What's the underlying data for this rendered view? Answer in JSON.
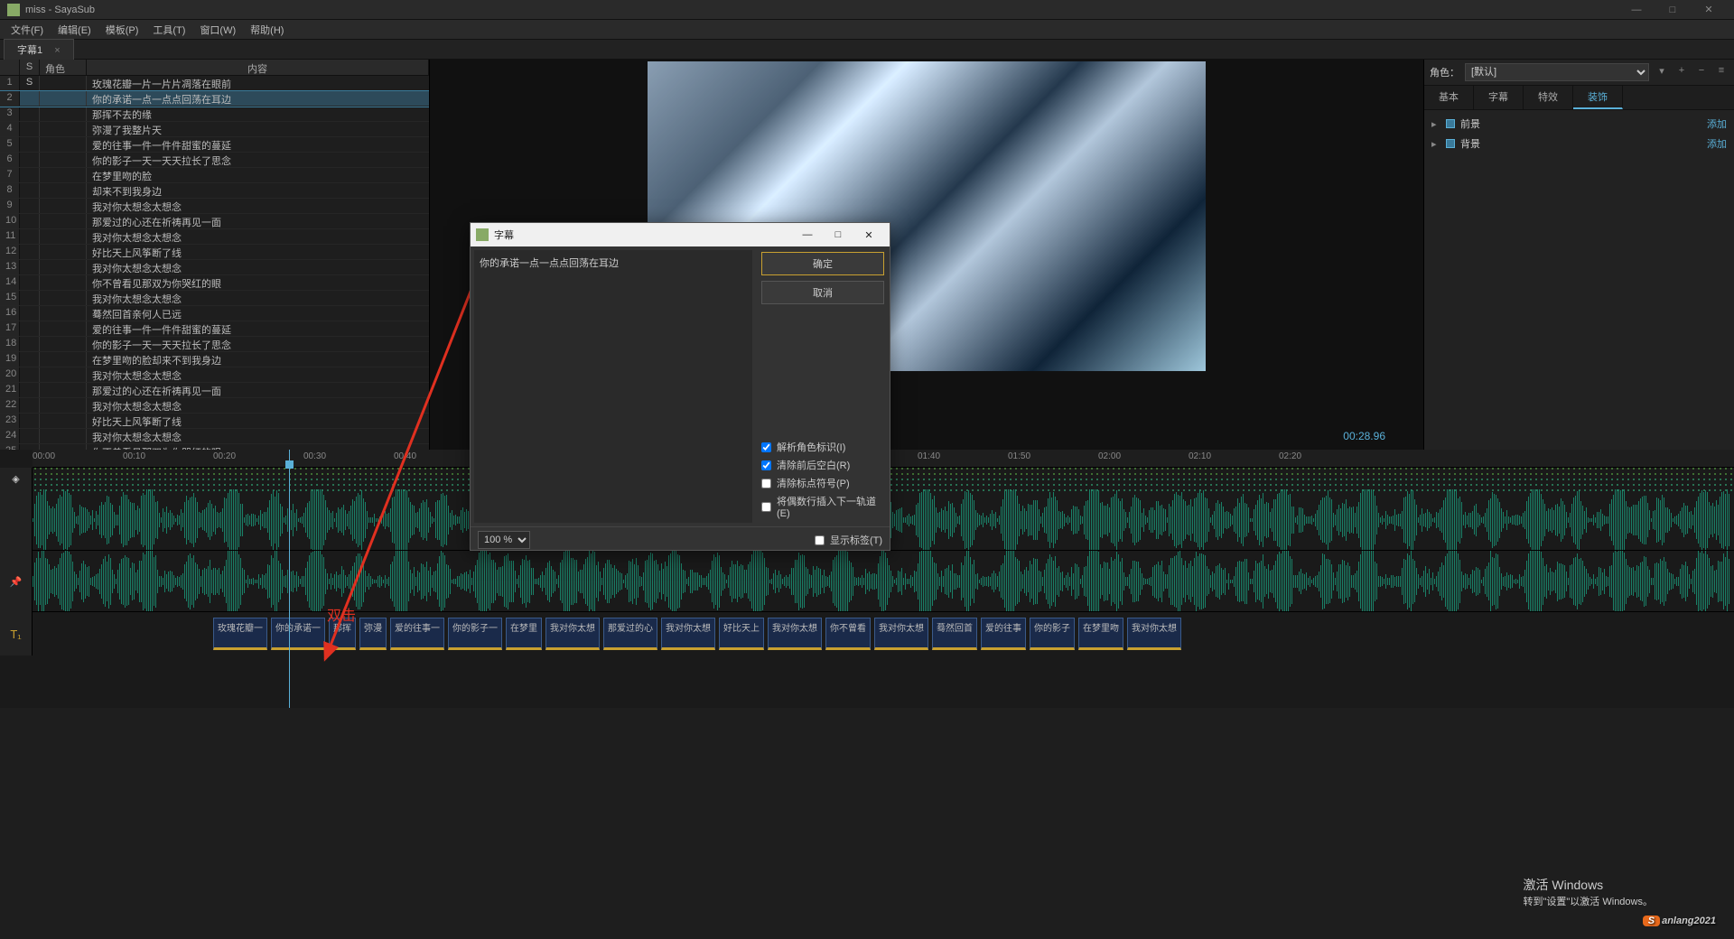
{
  "titlebar": {
    "title": "miss - SayaSub"
  },
  "menu": [
    "文件(F)",
    "编辑(E)",
    "模板(P)",
    "工具(T)",
    "窗口(W)",
    "帮助(H)"
  ],
  "tab": {
    "name": "字幕1"
  },
  "table": {
    "headers": {
      "s": "S",
      "role": "角色",
      "content": "内容"
    },
    "rows": [
      {
        "n": "1",
        "s": "S",
        "content": "玫瑰花瓣一片一片片凋落在眼前"
      },
      {
        "n": "2",
        "s": "",
        "content": "你的承诺一点一点点回荡在耳边",
        "selected": true
      },
      {
        "n": "3",
        "s": "",
        "content": "那挥不去的缘"
      },
      {
        "n": "4",
        "s": "",
        "content": "弥漫了我整片天"
      },
      {
        "n": "5",
        "s": "",
        "content": "爱的往事一件一件件甜蜜的蔓延"
      },
      {
        "n": "6",
        "s": "",
        "content": "你的影子一天一天天拉长了思念"
      },
      {
        "n": "7",
        "s": "",
        "content": "在梦里吻的脸"
      },
      {
        "n": "8",
        "s": "",
        "content": "却来不到我身边"
      },
      {
        "n": "9",
        "s": "",
        "content": "我对你太想念太想念"
      },
      {
        "n": "10",
        "s": "",
        "content": "那爱过的心还在祈祷再见一面"
      },
      {
        "n": "11",
        "s": "",
        "content": "我对你太想念太想念"
      },
      {
        "n": "12",
        "s": "",
        "content": "好比天上风筝断了线"
      },
      {
        "n": "13",
        "s": "",
        "content": "我对你太想念太想念"
      },
      {
        "n": "14",
        "s": "",
        "content": "你不曾看见那双为你哭红的眼"
      },
      {
        "n": "15",
        "s": "",
        "content": "我对你太想念太想念"
      },
      {
        "n": "16",
        "s": "",
        "content": "蓦然回首亲何人已远"
      },
      {
        "n": "17",
        "s": "",
        "content": "爱的往事一件一件件甜蜜的蔓延"
      },
      {
        "n": "18",
        "s": "",
        "content": "你的影子一天一天天拉长了思念"
      },
      {
        "n": "19",
        "s": "",
        "content": "在梦里吻的脸却来不到我身边"
      },
      {
        "n": "20",
        "s": "",
        "content": "我对你太想念太想念"
      },
      {
        "n": "21",
        "s": "",
        "content": "那爱过的心还在祈祷再见一面"
      },
      {
        "n": "22",
        "s": "",
        "content": "我对你太想念太想念"
      },
      {
        "n": "23",
        "s": "",
        "content": "好比天上风筝断了线"
      },
      {
        "n": "24",
        "s": "",
        "content": "我对你太想念太想念"
      },
      {
        "n": "25",
        "s": "",
        "content": "你不曾看见那双为你哭红的眼"
      }
    ]
  },
  "preview": {
    "timecode": "00:28.96"
  },
  "right": {
    "role_label": "角色：",
    "role_value": "[默认]",
    "tabs": [
      "基本",
      "字幕",
      "特效",
      "装饰"
    ],
    "active_tab": 3,
    "props": [
      {
        "label": "前景",
        "action": "添加"
      },
      {
        "label": "背景",
        "action": "添加"
      }
    ]
  },
  "timeline": {
    "ticks": [
      "00:00",
      "00:10",
      "00:20",
      "00:30",
      "00:40",
      "01:40",
      "01:50",
      "02:00",
      "02:10",
      "02:20"
    ],
    "track_label": "T₁",
    "clips": [
      "玫瑰花瓣一",
      "你的承诺一",
      "那挥",
      "弥漫",
      "爱的往事一",
      "你的影子一",
      "在梦里",
      "我对你太想",
      "那爱过的心",
      "我对你太想",
      "好比天上",
      "我对你太想",
      "你不曾看",
      "我对你太想",
      "蓦然回首",
      "爱的往事",
      "你的影子",
      "在梦里吻",
      "我对你太想"
    ]
  },
  "dialog": {
    "title": "字幕",
    "text": "你的承诺一点一点点回荡在耳边",
    "ok": "确定",
    "cancel": "取消",
    "checks": [
      {
        "label": "解析角色标识(I)",
        "checked": true
      },
      {
        "label": "清除前后空白(R)",
        "checked": true
      },
      {
        "label": "清除标点符号(P)",
        "checked": false
      },
      {
        "label": "将偶数行插入下一轨道(E)",
        "checked": false
      }
    ],
    "zoom": "100 %",
    "show_label": "显示标签(T)"
  },
  "annotation": {
    "text": "双击"
  },
  "activation": {
    "line1": "激活 Windows",
    "line2": "转到\"设置\"以激活 Windows。"
  },
  "watermark": "sanlang2021"
}
